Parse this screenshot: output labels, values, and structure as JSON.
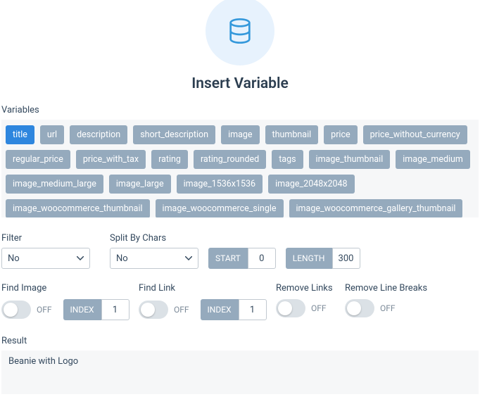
{
  "title": "Insert Variable",
  "labels": {
    "variables": "Variables",
    "filter": "Filter",
    "split": "Split By Chars",
    "start": "START",
    "length": "LENGTH",
    "find_image": "Find Image",
    "find_link": "Find Link",
    "remove_links": "Remove Links",
    "remove_line_breaks": "Remove Line Breaks",
    "index": "INDEX",
    "off": "OFF",
    "result": "Result"
  },
  "variables": [
    {
      "name": "title",
      "active": true
    },
    {
      "name": "url"
    },
    {
      "name": "description"
    },
    {
      "name": "short_description"
    },
    {
      "name": "image"
    },
    {
      "name": "thumbnail"
    },
    {
      "name": "price"
    },
    {
      "name": "price_without_currency"
    },
    {
      "name": "regular_price"
    },
    {
      "name": "price_with_tax"
    },
    {
      "name": "rating"
    },
    {
      "name": "rating_rounded"
    },
    {
      "name": "tags"
    },
    {
      "name": "image_thumbnail"
    },
    {
      "name": "image_medium"
    },
    {
      "name": "image_medium_large"
    },
    {
      "name": "image_large"
    },
    {
      "name": "image_1536x1536"
    },
    {
      "name": "image_2048x2048"
    },
    {
      "name": "image_woocommerce_thumbnail"
    },
    {
      "name": "image_woocommerce_single"
    },
    {
      "name": "image_woocommerce_gallery_thumbnail"
    }
  ],
  "filter": {
    "value": "No"
  },
  "split": {
    "value": "No"
  },
  "start": {
    "value": "0"
  },
  "length": {
    "value": "300"
  },
  "find_image": {
    "index": "1"
  },
  "find_link": {
    "index": "1"
  },
  "result": "Beanie with Logo"
}
